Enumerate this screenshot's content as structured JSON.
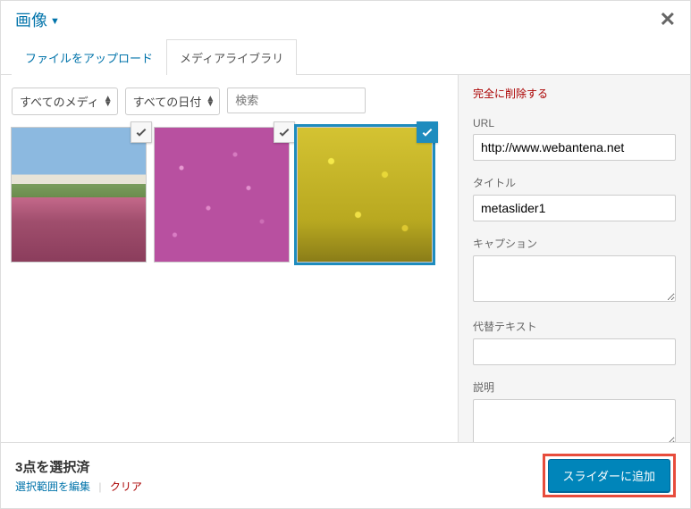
{
  "header": {
    "title": "画像"
  },
  "tabs": {
    "upload": "ファイルをアップロード",
    "library": "メディアライブラリ"
  },
  "filters": {
    "media": "すべてのメディ",
    "date": "すべての日付",
    "search_placeholder": "検索"
  },
  "thumbs": [
    {
      "checked": true,
      "active": false
    },
    {
      "checked": true,
      "active": false
    },
    {
      "checked": true,
      "active": true
    }
  ],
  "sidebar": {
    "delete": "完全に削除する",
    "url": {
      "label": "URL",
      "value": "http://www.webantena.net"
    },
    "title": {
      "label": "タイトル",
      "value": "metaslider1"
    },
    "caption": {
      "label": "キャプション",
      "value": ""
    },
    "alt": {
      "label": "代替テキスト",
      "value": ""
    },
    "desc": {
      "label": "説明",
      "value": ""
    }
  },
  "footer": {
    "count": "3点を選択済",
    "edit": "選択範囲を編集",
    "clear": "クリア",
    "button": "スライダーに追加"
  }
}
